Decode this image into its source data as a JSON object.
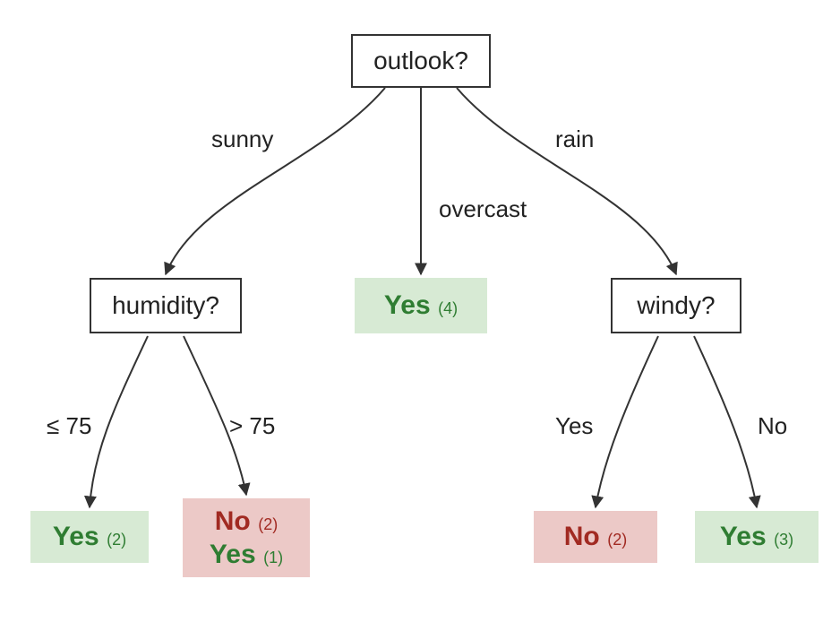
{
  "tree": {
    "root": {
      "label": "outlook?"
    },
    "humidity": {
      "label": "humidity?"
    },
    "windy": {
      "label": "windy?"
    },
    "edge_sunny": "sunny",
    "edge_overcast": "overcast",
    "edge_rain": "rain",
    "edge_hum_le": "≤ 75",
    "edge_hum_gt": "> 75",
    "edge_wind_yes": "Yes",
    "edge_wind_no": "No",
    "leaf_overcast": {
      "result": "Yes",
      "count": "(4)"
    },
    "leaf_hum_le": {
      "result": "Yes",
      "count": "(2)"
    },
    "leaf_hum_gt": {
      "primary_result": "No",
      "primary_count": "(2)",
      "secondary_result": "Yes",
      "secondary_count": "(1)"
    },
    "leaf_wind_yes": {
      "result": "No",
      "count": "(2)"
    },
    "leaf_wind_no": {
      "result": "Yes",
      "count": "(3)"
    }
  },
  "colors": {
    "yes_bg": "#d7ead4",
    "no_bg": "#ecc9c7",
    "yes_fg": "#2f7d32",
    "no_fg": "#a12a22",
    "line": "#333333"
  }
}
